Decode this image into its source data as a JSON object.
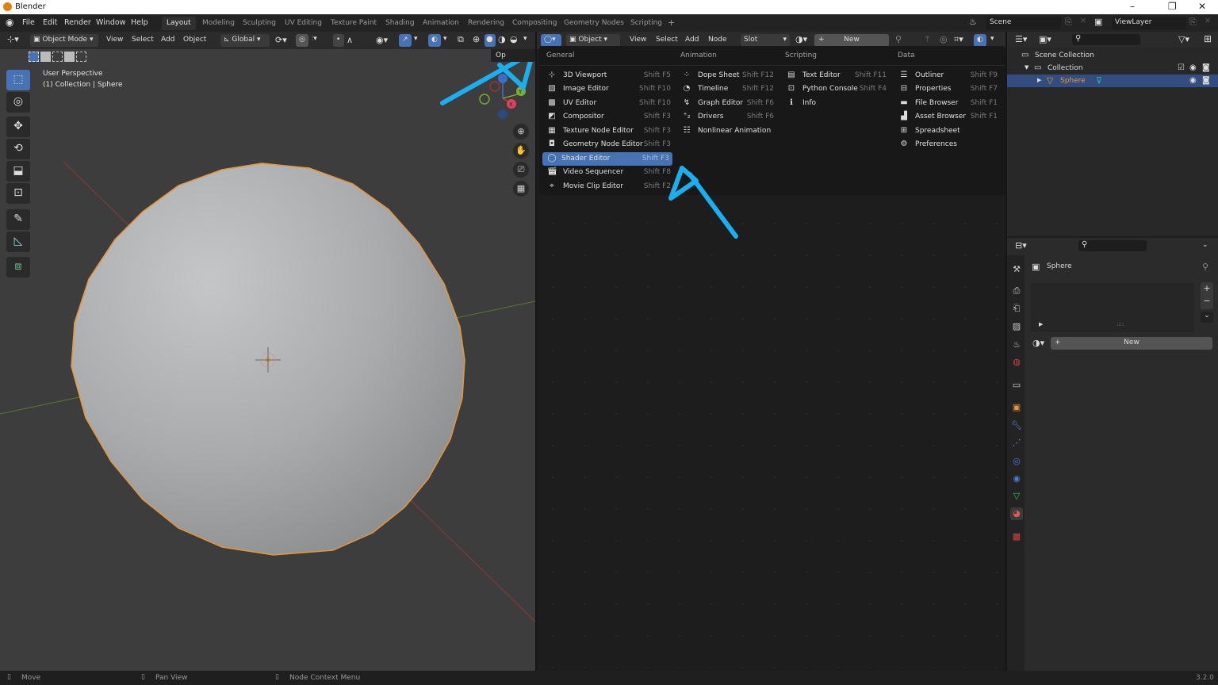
{
  "window": {
    "title": "Blender",
    "controls": [
      "minimize",
      "restore",
      "close"
    ]
  },
  "menubar": {
    "items": [
      "File",
      "Edit",
      "Render",
      "Window",
      "Help"
    ]
  },
  "workspaces": [
    "Layout",
    "Modeling",
    "Sculpting",
    "UV Editing",
    "Texture Paint",
    "Shading",
    "Animation",
    "Rendering",
    "Compositing",
    "Geometry Nodes",
    "Scripting"
  ],
  "active_workspace": "Layout",
  "add_workspace": "+",
  "scene": {
    "name": "Scene",
    "view_layer": "ViewLayer"
  },
  "viewport_header": {
    "mode": "Object Mode",
    "menus": [
      "View",
      "Select",
      "Add",
      "Object"
    ],
    "orientation": "Global"
  },
  "viewport": {
    "overlay_line1": "User Perspective",
    "overlay_line2": "(1) Collection | Sphere",
    "options_label": "Op",
    "gizmo_axes": [
      "X",
      "Y",
      "Z"
    ],
    "tools": [
      "Select Box",
      "Cursor",
      "Move",
      "Rotate",
      "Scale",
      "Transform",
      "Annotate",
      "Measure",
      "Add Cube"
    ]
  },
  "node_header": {
    "object_label": "Object",
    "menus": [
      "View",
      "Select",
      "Add",
      "Node"
    ],
    "slot": "Slot",
    "new_label": "New"
  },
  "editor_menu": {
    "columns": [
      {
        "title": "General",
        "items": [
          {
            "label": "3D Viewport",
            "shortcut": "Shift F5",
            "icon": "viewport-icon"
          },
          {
            "label": "Image Editor",
            "shortcut": "Shift F10",
            "icon": "image-icon"
          },
          {
            "label": "UV Editor",
            "shortcut": "Shift F10",
            "icon": "uv-icon"
          },
          {
            "label": "Compositor",
            "shortcut": "Shift F3",
            "icon": "compositor-icon"
          },
          {
            "label": "Texture Node Editor",
            "shortcut": "Shift F3",
            "icon": "texture-icon"
          },
          {
            "label": "Geometry Node Editor",
            "shortcut": "Shift F3",
            "icon": "geometry-icon"
          },
          {
            "label": "Shader Editor",
            "shortcut": "Shift F3",
            "icon": "shader-icon",
            "highlighted": true
          },
          {
            "label": "Video Sequencer",
            "shortcut": "Shift F8",
            "icon": "sequencer-icon"
          },
          {
            "label": "Movie Clip Editor",
            "shortcut": "Shift F2",
            "icon": "clip-icon"
          }
        ]
      },
      {
        "title": "Animation",
        "items": [
          {
            "label": "Dope Sheet",
            "shortcut": "Shift F12",
            "icon": "dopesheet-icon"
          },
          {
            "label": "Timeline",
            "shortcut": "Shift F12",
            "icon": "timeline-icon"
          },
          {
            "label": "Graph Editor",
            "shortcut": "Shift F6",
            "icon": "graph-icon"
          },
          {
            "label": "Drivers",
            "shortcut": "Shift F6",
            "icon": "drivers-icon"
          },
          {
            "label": "Nonlinear Animation",
            "shortcut": "",
            "icon": "nla-icon"
          }
        ]
      },
      {
        "title": "Scripting",
        "items": [
          {
            "label": "Text Editor",
            "shortcut": "Shift F11",
            "icon": "text-icon"
          },
          {
            "label": "Python Console",
            "shortcut": "Shift F4",
            "icon": "console-icon"
          },
          {
            "label": "Info",
            "shortcut": "",
            "icon": "info-icon"
          }
        ]
      },
      {
        "title": "Data",
        "items": [
          {
            "label": "Outliner",
            "shortcut": "Shift F9",
            "icon": "outliner-icon"
          },
          {
            "label": "Properties",
            "shortcut": "Shift F7",
            "icon": "properties-icon"
          },
          {
            "label": "File Browser",
            "shortcut": "Shift F1",
            "icon": "folder-icon"
          },
          {
            "label": "Asset Browser",
            "shortcut": "Shift F1",
            "icon": "asset-icon"
          },
          {
            "label": "Spreadsheet",
            "shortcut": "",
            "icon": "spreadsheet-icon"
          },
          {
            "label": "Preferences",
            "shortcut": "",
            "icon": "gear-icon"
          }
        ]
      }
    ]
  },
  "outliner": {
    "items": [
      {
        "label": "Scene Collection",
        "level": 0
      },
      {
        "label": "Collection",
        "level": 1
      },
      {
        "label": "Sphere",
        "level": 2,
        "selected": true
      }
    ]
  },
  "properties": {
    "object_name": "Sphere",
    "new_label": "New"
  },
  "statusbar": {
    "items": [
      "Move",
      "Pan View",
      "Node Context Menu"
    ],
    "version": "3.2.0"
  },
  "colors": {
    "accent": "#4772b3",
    "selection": "#e8963a",
    "annotation": "#1ab0f0"
  }
}
